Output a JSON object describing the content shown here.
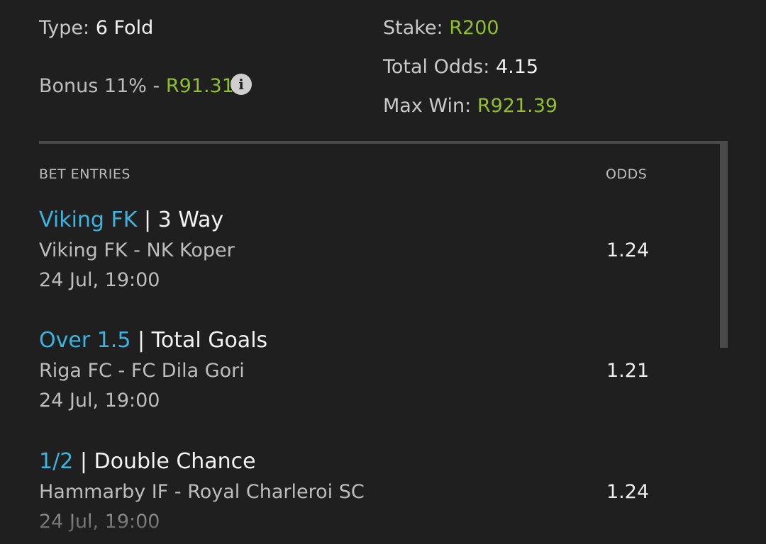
{
  "summary": {
    "type_label": "Type:",
    "type_value": "6 Fold",
    "bonus_label": "Bonus 11% -",
    "bonus_value": "R91.31",
    "stake_label": "Stake:",
    "stake_value": "R200",
    "total_odds_label": "Total Odds:",
    "total_odds_value": "4.15",
    "max_win_label": "Max Win:",
    "max_win_value": "R921.39",
    "info_icon": "info-icon",
    "info_glyph": "i"
  },
  "table": {
    "entries_header": "BET ENTRIES",
    "odds_header": "ODDS"
  },
  "entries": [
    {
      "selection": "Viking FK",
      "separator": "|",
      "market": "3 Way",
      "match": "Viking FK - NK Koper",
      "time": "24 Jul, 19:00",
      "odds": "1.24"
    },
    {
      "selection": "Over 1.5",
      "separator": "|",
      "market": "Total Goals",
      "match": "Riga FC - FC Dila Gori",
      "time": "24 Jul, 19:00",
      "odds": "1.21"
    },
    {
      "selection": "1/2",
      "separator": "|",
      "market": "Double Chance",
      "match": "Hammarby IF - Royal Charleroi SC",
      "time": "24 Jul, 19:00",
      "odds": "1.24"
    }
  ],
  "colors": {
    "background": "#1f1f1f",
    "selection": "#3ab4e0",
    "money": "#8fbf2a"
  }
}
